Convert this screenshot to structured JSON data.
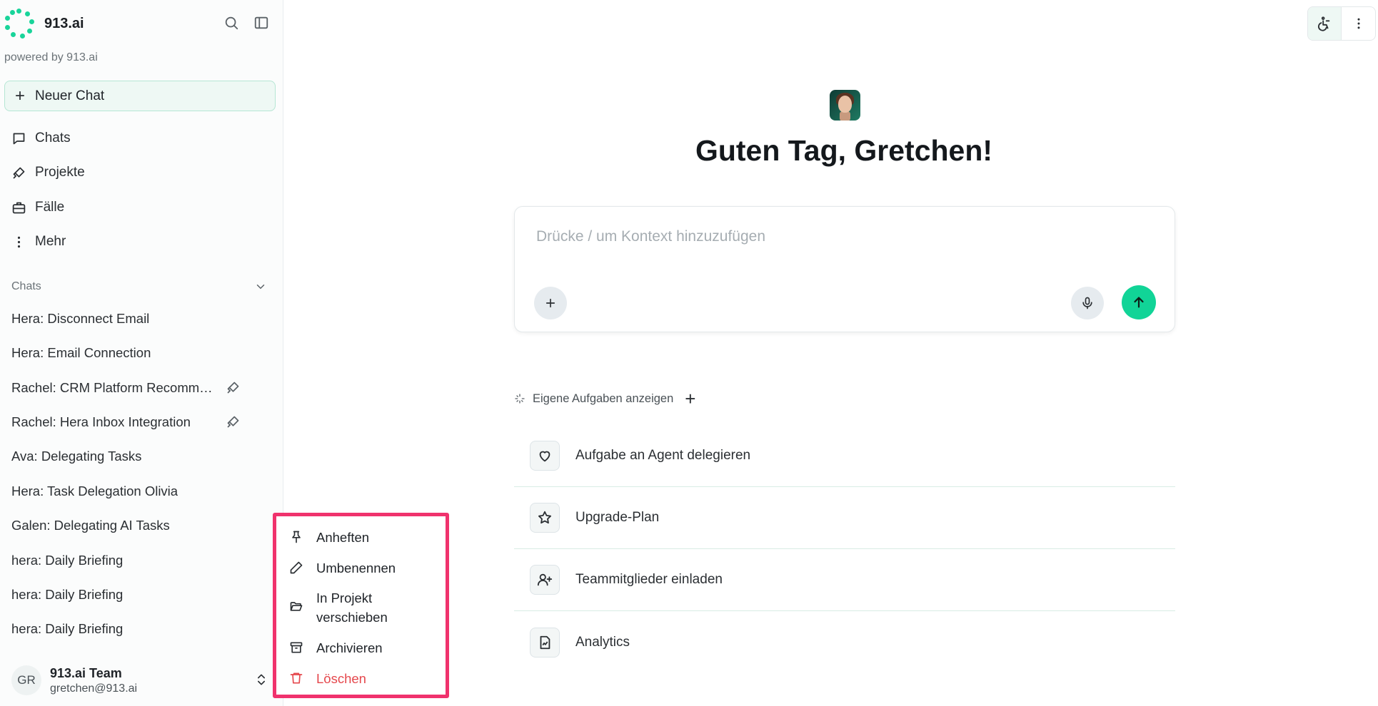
{
  "brand": {
    "name": "913.ai",
    "powered_by": "powered by 913.ai"
  },
  "sidebar": {
    "new_chat": "Neuer Chat",
    "nav": [
      {
        "label": "Chats",
        "icon": "chat-bubble-icon"
      },
      {
        "label": "Projekte",
        "icon": "rocket-icon"
      },
      {
        "label": "Fälle",
        "icon": "briefcase-icon"
      },
      {
        "label": "Mehr",
        "icon": "more-vertical-icon"
      }
    ],
    "chats_section": "Chats",
    "chats": [
      {
        "title": "Hera: Disconnect Email"
      },
      {
        "title": "Hera: Email Connection"
      },
      {
        "title": "Rachel: CRM Platform Recommendations",
        "project_icon": true
      },
      {
        "title": "Rachel: Hera Inbox Integration",
        "project_icon": true
      },
      {
        "title": "Ava: Delegating Tasks"
      },
      {
        "title": "Hera: Task Delegation Olivia"
      },
      {
        "title": "Galen: Delegating AI Tasks"
      },
      {
        "title": "hera: Daily Briefing"
      },
      {
        "title": "hera: Daily Briefing"
      },
      {
        "title": "hera: Daily Briefing"
      }
    ],
    "account": {
      "initials": "GR",
      "team": "913.ai Team",
      "email": "gretchen@913.ai"
    }
  },
  "context_menu": {
    "items": [
      {
        "label": "Anheften",
        "icon": "pin-icon"
      },
      {
        "label": "Umbenennen",
        "icon": "pencil-icon"
      },
      {
        "label": "In Projekt verschieben",
        "icon": "folder-open-icon"
      },
      {
        "label": "Archivieren",
        "icon": "archive-icon"
      },
      {
        "label": "Löschen",
        "icon": "trash-icon"
      }
    ],
    "highlight_color": "#f0326d",
    "danger_color": "#e5484d"
  },
  "main": {
    "greeting": "Guten Tag, Gretchen!",
    "composer_placeholder": "Drücke / um Kontext hinzuzufügen",
    "tasks_toggle": "Eigene Aufgaben anzeigen",
    "actions": [
      {
        "label": "Aufgabe an Agent delegieren",
        "icon": "heart-icon"
      },
      {
        "label": "Upgrade-Plan",
        "icon": "star-icon"
      },
      {
        "label": "Teammitglieder einladen",
        "icon": "user-plus-icon"
      },
      {
        "label": "Analytics",
        "icon": "file-chart-icon"
      }
    ]
  },
  "colors": {
    "accent": "#11d497",
    "accent_soft": "#eef8f4"
  }
}
